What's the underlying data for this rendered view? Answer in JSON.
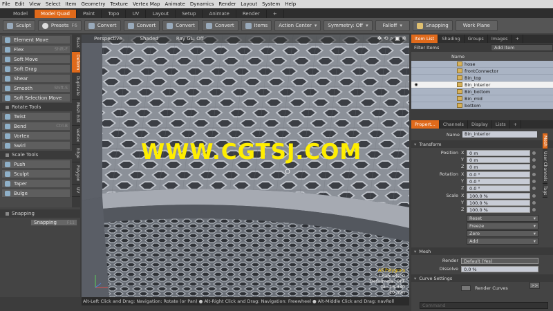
{
  "menu": [
    "File",
    "Edit",
    "View",
    "Select",
    "Item",
    "Geometry",
    "Texture",
    "Vertex Map",
    "Animate",
    "Dynamics",
    "Render",
    "Layout",
    "System",
    "Help"
  ],
  "layout_tabs": [
    "Model",
    "Model Quad",
    "Paint",
    "Topo",
    "UV",
    "Layout",
    "Setup",
    "Animate",
    "Render",
    "+"
  ],
  "toolbar": {
    "sculpt": "Sculpt",
    "presets": "Presets",
    "presets_key": "F6",
    "convert1": "Convert",
    "convert2": "Convert",
    "convert3": "Convert",
    "convert4": "Convert",
    "items": "Items",
    "action_center": "Action Center",
    "symmetry": "Symmetry: Off",
    "falloff": "Falloff",
    "snapping": "Snapping",
    "work_plane": "Work Plane"
  },
  "left_panel": {
    "tools1": [
      {
        "label": "Element Move",
        "key": ""
      },
      {
        "label": "Flex",
        "key": "Shift-F"
      },
      {
        "label": "Soft Move",
        "key": ""
      },
      {
        "label": "Soft Drag",
        "key": ""
      },
      {
        "label": "Shear",
        "key": ""
      },
      {
        "label": "Smooth",
        "key": "Shift-S"
      },
      {
        "label": "Soft Selection Move",
        "key": ""
      }
    ],
    "group_rotate": "Rotate Tools",
    "tools2": [
      {
        "label": "Twist",
        "key": ""
      },
      {
        "label": "Bend",
        "key": "Ctrl-B"
      },
      {
        "label": "Vortex",
        "key": ""
      },
      {
        "label": "Swirl",
        "key": ""
      }
    ],
    "group_scale": "Scale Tools",
    "tools3": [
      {
        "label": "Push",
        "key": ""
      },
      {
        "label": "Sculpt",
        "key": ""
      },
      {
        "label": "Taper",
        "key": ""
      },
      {
        "label": "Bulge",
        "key": ""
      }
    ],
    "vtabs": [
      "Basic",
      "Deform",
      "Duplicate",
      "Mesh Edit",
      "Vertex",
      "Edge",
      "Polygon",
      "UV"
    ],
    "snapping_group": "Snapping",
    "snapping_button": "Snapping",
    "snapping_key": "F11"
  },
  "viewport": {
    "view": "Perspective",
    "shading": "Shaded",
    "ray_gl": "Ray GL: Off",
    "watermark": "WWW.CGTSJ.COM",
    "stats": {
      "selection": "All Polygons",
      "channels": "Channels: 0",
      "deformers": "Deformers: OFF",
      "gl": "GL: 16,330",
      "scale": "20 mm"
    }
  },
  "status_bar": "Alt-Left Click and Drag: Navigation: Rotate (or Pan) ● Alt-Right Click and Drag: Navigation: Freewheel ● Alt-Middle Click and Drag: navRoll",
  "item_list": {
    "tabs": [
      "Item List",
      "Shading",
      "Groups",
      "Images",
      "+"
    ],
    "filter": "Filter Items",
    "add_item": "Add Item",
    "column_name": "Name",
    "items": [
      "hose",
      "frontConnector",
      "Bin_top",
      "Bin_interior",
      "Bin_bottom",
      "Bin_mid",
      "bottom"
    ],
    "selected_index": 3
  },
  "properties": {
    "tabs": [
      "Propert...",
      "Channels",
      "Display",
      "Lists",
      "+"
    ],
    "name_label": "Name",
    "name_value": "Bin_interior",
    "section_transform": "Transform",
    "position_label": "Position",
    "rotation_label": "Rotation",
    "scale_label": "Scale",
    "position": [
      "0 m",
      "0 m",
      "0 m"
    ],
    "rotation": [
      "0.0 °",
      "0.0 °",
      "0.0 °"
    ],
    "scale": [
      "100.0 %",
      "100.0 %",
      "100.0 %"
    ],
    "axes": [
      "X",
      "Y",
      "Z"
    ],
    "buttons": [
      "Reset",
      "Freeze",
      "Zero",
      "Add"
    ],
    "section_mesh": "Mesh",
    "render_label": "Render",
    "render_value": "Default (Yes)",
    "dissolve_label": "Dissolve",
    "dissolve_value": "0.0 %",
    "section_curve": "Curve Settings",
    "render_curves": "Render Curves",
    "more": ">>",
    "command_placeholder": "Command",
    "side_tabs": [
      "Mesh",
      "User Channels",
      "Tags"
    ]
  }
}
